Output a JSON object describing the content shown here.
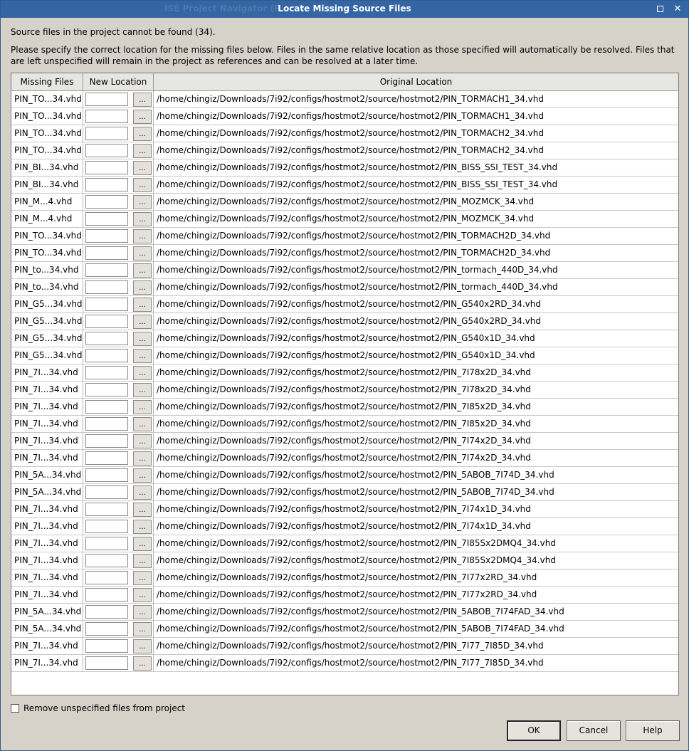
{
  "window": {
    "background_title": "ISE Project Navigator (P.",
    "title": "Locate Missing Source Files",
    "maximize_icon": "maximize-icon",
    "close_glyph": "✕"
  },
  "message": {
    "count_line": "Source files in the project cannot be found (34).",
    "instructions": "Please specify the correct location for the missing files below. Files in the same relative location as those specified will automatically be resolved. Files that are left unspecified will remain in the project as references and can be resolved at a later time."
  },
  "table": {
    "headers": [
      "Missing Files",
      "New Location",
      "Original Location"
    ],
    "browse_label": "...",
    "rows": [
      [
        "PIN_TO...34.vhd",
        "/home/chingiz/Downloads/7i92/configs/hostmot2/source/hostmot2/PIN_TORMACH1_34.vhd"
      ],
      [
        "PIN_TO...34.vhd",
        "/home/chingiz/Downloads/7i92/configs/hostmot2/source/hostmot2/PIN_TORMACH1_34.vhd"
      ],
      [
        "PIN_TO...34.vhd",
        "/home/chingiz/Downloads/7i92/configs/hostmot2/source/hostmot2/PIN_TORMACH2_34.vhd"
      ],
      [
        "PIN_TO...34.vhd",
        "/home/chingiz/Downloads/7i92/configs/hostmot2/source/hostmot2/PIN_TORMACH2_34.vhd"
      ],
      [
        "PIN_BI...34.vhd",
        "/home/chingiz/Downloads/7i92/configs/hostmot2/source/hostmot2/PIN_BISS_SSI_TEST_34.vhd"
      ],
      [
        "PIN_BI...34.vhd",
        "/home/chingiz/Downloads/7i92/configs/hostmot2/source/hostmot2/PIN_BISS_SSI_TEST_34.vhd"
      ],
      [
        "PIN_M...4.vhd",
        "/home/chingiz/Downloads/7i92/configs/hostmot2/source/hostmot2/PIN_MOZMCK_34.vhd"
      ],
      [
        "PIN_M...4.vhd",
        "/home/chingiz/Downloads/7i92/configs/hostmot2/source/hostmot2/PIN_MOZMCK_34.vhd"
      ],
      [
        "PIN_TO...34.vhd",
        "/home/chingiz/Downloads/7i92/configs/hostmot2/source/hostmot2/PIN_TORMACH2D_34.vhd"
      ],
      [
        "PIN_TO...34.vhd",
        "/home/chingiz/Downloads/7i92/configs/hostmot2/source/hostmot2/PIN_TORMACH2D_34.vhd"
      ],
      [
        "PIN_to...34.vhd",
        "/home/chingiz/Downloads/7i92/configs/hostmot2/source/hostmot2/PIN_tormach_440D_34.vhd"
      ],
      [
        "PIN_to...34.vhd",
        "/home/chingiz/Downloads/7i92/configs/hostmot2/source/hostmot2/PIN_tormach_440D_34.vhd"
      ],
      [
        "PIN_G5...34.vhd",
        "/home/chingiz/Downloads/7i92/configs/hostmot2/source/hostmot2/PIN_G540x2RD_34.vhd"
      ],
      [
        "PIN_G5...34.vhd",
        "/home/chingiz/Downloads/7i92/configs/hostmot2/source/hostmot2/PIN_G540x2RD_34.vhd"
      ],
      [
        "PIN_G5...34.vhd",
        "/home/chingiz/Downloads/7i92/configs/hostmot2/source/hostmot2/PIN_G540x1D_34.vhd"
      ],
      [
        "PIN_G5...34.vhd",
        "/home/chingiz/Downloads/7i92/configs/hostmot2/source/hostmot2/PIN_G540x1D_34.vhd"
      ],
      [
        "PIN_7I...34.vhd",
        "/home/chingiz/Downloads/7i92/configs/hostmot2/source/hostmot2/PIN_7I78x2D_34.vhd"
      ],
      [
        "PIN_7I...34.vhd",
        "/home/chingiz/Downloads/7i92/configs/hostmot2/source/hostmot2/PIN_7I78x2D_34.vhd"
      ],
      [
        "PIN_7I...34.vhd",
        "/home/chingiz/Downloads/7i92/configs/hostmot2/source/hostmot2/PIN_7I85x2D_34.vhd"
      ],
      [
        "PIN_7I...34.vhd",
        "/home/chingiz/Downloads/7i92/configs/hostmot2/source/hostmot2/PIN_7I85x2D_34.vhd"
      ],
      [
        "PIN_7I...34.vhd",
        "/home/chingiz/Downloads/7i92/configs/hostmot2/source/hostmot2/PIN_7I74x2D_34.vhd"
      ],
      [
        "PIN_7I...34.vhd",
        "/home/chingiz/Downloads/7i92/configs/hostmot2/source/hostmot2/PIN_7I74x2D_34.vhd"
      ],
      [
        "PIN_5A...34.vhd",
        "/home/chingiz/Downloads/7i92/configs/hostmot2/source/hostmot2/PIN_5ABOB_7I74D_34.vhd"
      ],
      [
        "PIN_5A...34.vhd",
        "/home/chingiz/Downloads/7i92/configs/hostmot2/source/hostmot2/PIN_5ABOB_7I74D_34.vhd"
      ],
      [
        "PIN_7I...34.vhd",
        "/home/chingiz/Downloads/7i92/configs/hostmot2/source/hostmot2/PIN_7I74x1D_34.vhd"
      ],
      [
        "PIN_7I...34.vhd",
        "/home/chingiz/Downloads/7i92/configs/hostmot2/source/hostmot2/PIN_7I74x1D_34.vhd"
      ],
      [
        "PIN_7I...34.vhd",
        "/home/chingiz/Downloads/7i92/configs/hostmot2/source/hostmot2/PIN_7I85Sx2DMQ4_34.vhd"
      ],
      [
        "PIN_7I...34.vhd",
        "/home/chingiz/Downloads/7i92/configs/hostmot2/source/hostmot2/PIN_7I85Sx2DMQ4_34.vhd"
      ],
      [
        "PIN_7I...34.vhd",
        "/home/chingiz/Downloads/7i92/configs/hostmot2/source/hostmot2/PIN_7I77x2RD_34.vhd"
      ],
      [
        "PIN_7I...34.vhd",
        "/home/chingiz/Downloads/7i92/configs/hostmot2/source/hostmot2/PIN_7I77x2RD_34.vhd"
      ],
      [
        "PIN_5A...34.vhd",
        "/home/chingiz/Downloads/7i92/configs/hostmot2/source/hostmot2/PIN_5ABOB_7I74FAD_34.vhd"
      ],
      [
        "PIN_5A...34.vhd",
        "/home/chingiz/Downloads/7i92/configs/hostmot2/source/hostmot2/PIN_5ABOB_7I74FAD_34.vhd"
      ],
      [
        "PIN_7I...34.vhd",
        "/home/chingiz/Downloads/7i92/configs/hostmot2/source/hostmot2/PIN_7I77_7I85D_34.vhd"
      ],
      [
        "PIN_7I...34.vhd",
        "/home/chingiz/Downloads/7i92/configs/hostmot2/source/hostmot2/PIN_7I77_7I85D_34.vhd"
      ]
    ]
  },
  "remove_option": {
    "label": "Remove unspecified files from project",
    "checked": false
  },
  "buttons": {
    "ok": "OK",
    "cancel": "Cancel",
    "help": "Help"
  }
}
